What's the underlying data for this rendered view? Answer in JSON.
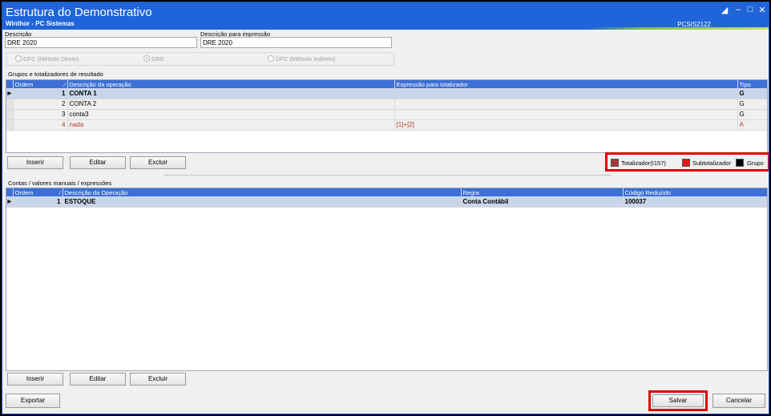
{
  "window": {
    "title": "Estrutura do Demonstrativo",
    "subtitle": "Winthor - PC Sistemas",
    "code": "PCSIS2122"
  },
  "form": {
    "descricao_label": "Descrição",
    "descricao_value": "DRE 2020",
    "impressao_label": "Descrição para impressão",
    "impressao_value": "DRE 2020",
    "radios": [
      {
        "label": "DFC (Método Direto)",
        "checked": false
      },
      {
        "label": "DRE",
        "checked": true
      },
      {
        "label": "DFC (Método Indireto)",
        "checked": false
      }
    ]
  },
  "grupos": {
    "section_label": "Grupos e totalizadores de resultado",
    "headers": [
      "Ordem",
      "Descrição da operação",
      "Expressão para totalizador",
      "Tipo"
    ],
    "rows": [
      {
        "ordem": "1",
        "descricao": "CONTA 1",
        "expressao": "",
        "tipo": "G"
      },
      {
        "ordem": "2",
        "descricao": "CONTA 2",
        "expressao": "",
        "tipo": "G"
      },
      {
        "ordem": "3",
        "descricao": "conta3",
        "expressao": "",
        "tipo": "G"
      },
      {
        "ordem": "4",
        "descricao": "nada",
        "expressao": "[1]+[2]",
        "tipo": "A"
      }
    ],
    "buttons": {
      "inserir": "Inserir",
      "editar": "Editar",
      "excluir": "Excluir"
    }
  },
  "legend": {
    "totalizador": "Totalizador(I157)",
    "subtotalizador": "Subtotalizador",
    "grupo": "Grupo",
    "colors": {
      "totalizador": "#a33a3a",
      "subtotalizador": "#e01818",
      "grupo": "#000000"
    }
  },
  "contas": {
    "section_label": "Contas / valores manuais / expressões",
    "headers": [
      "Ordem",
      "Descrição da Operação",
      "Regra",
      "Código Reduzido"
    ],
    "rows": [
      {
        "ordem": "1",
        "descricao": "ESTOQUE",
        "regra": "Conta Contábil",
        "codigo": "100037"
      }
    ],
    "buttons": {
      "inserir": "Inserir",
      "editar": "Editar",
      "excluir": "Excluir"
    }
  },
  "footer": {
    "exportar": "Exportar",
    "salvar": "Salvar",
    "cancelar": "Cancelar"
  },
  "icons": [
    "restore-icon",
    "minimize-icon",
    "maximize-icon",
    "close-icon",
    "row-indicator-icon",
    "sort-icon"
  ]
}
